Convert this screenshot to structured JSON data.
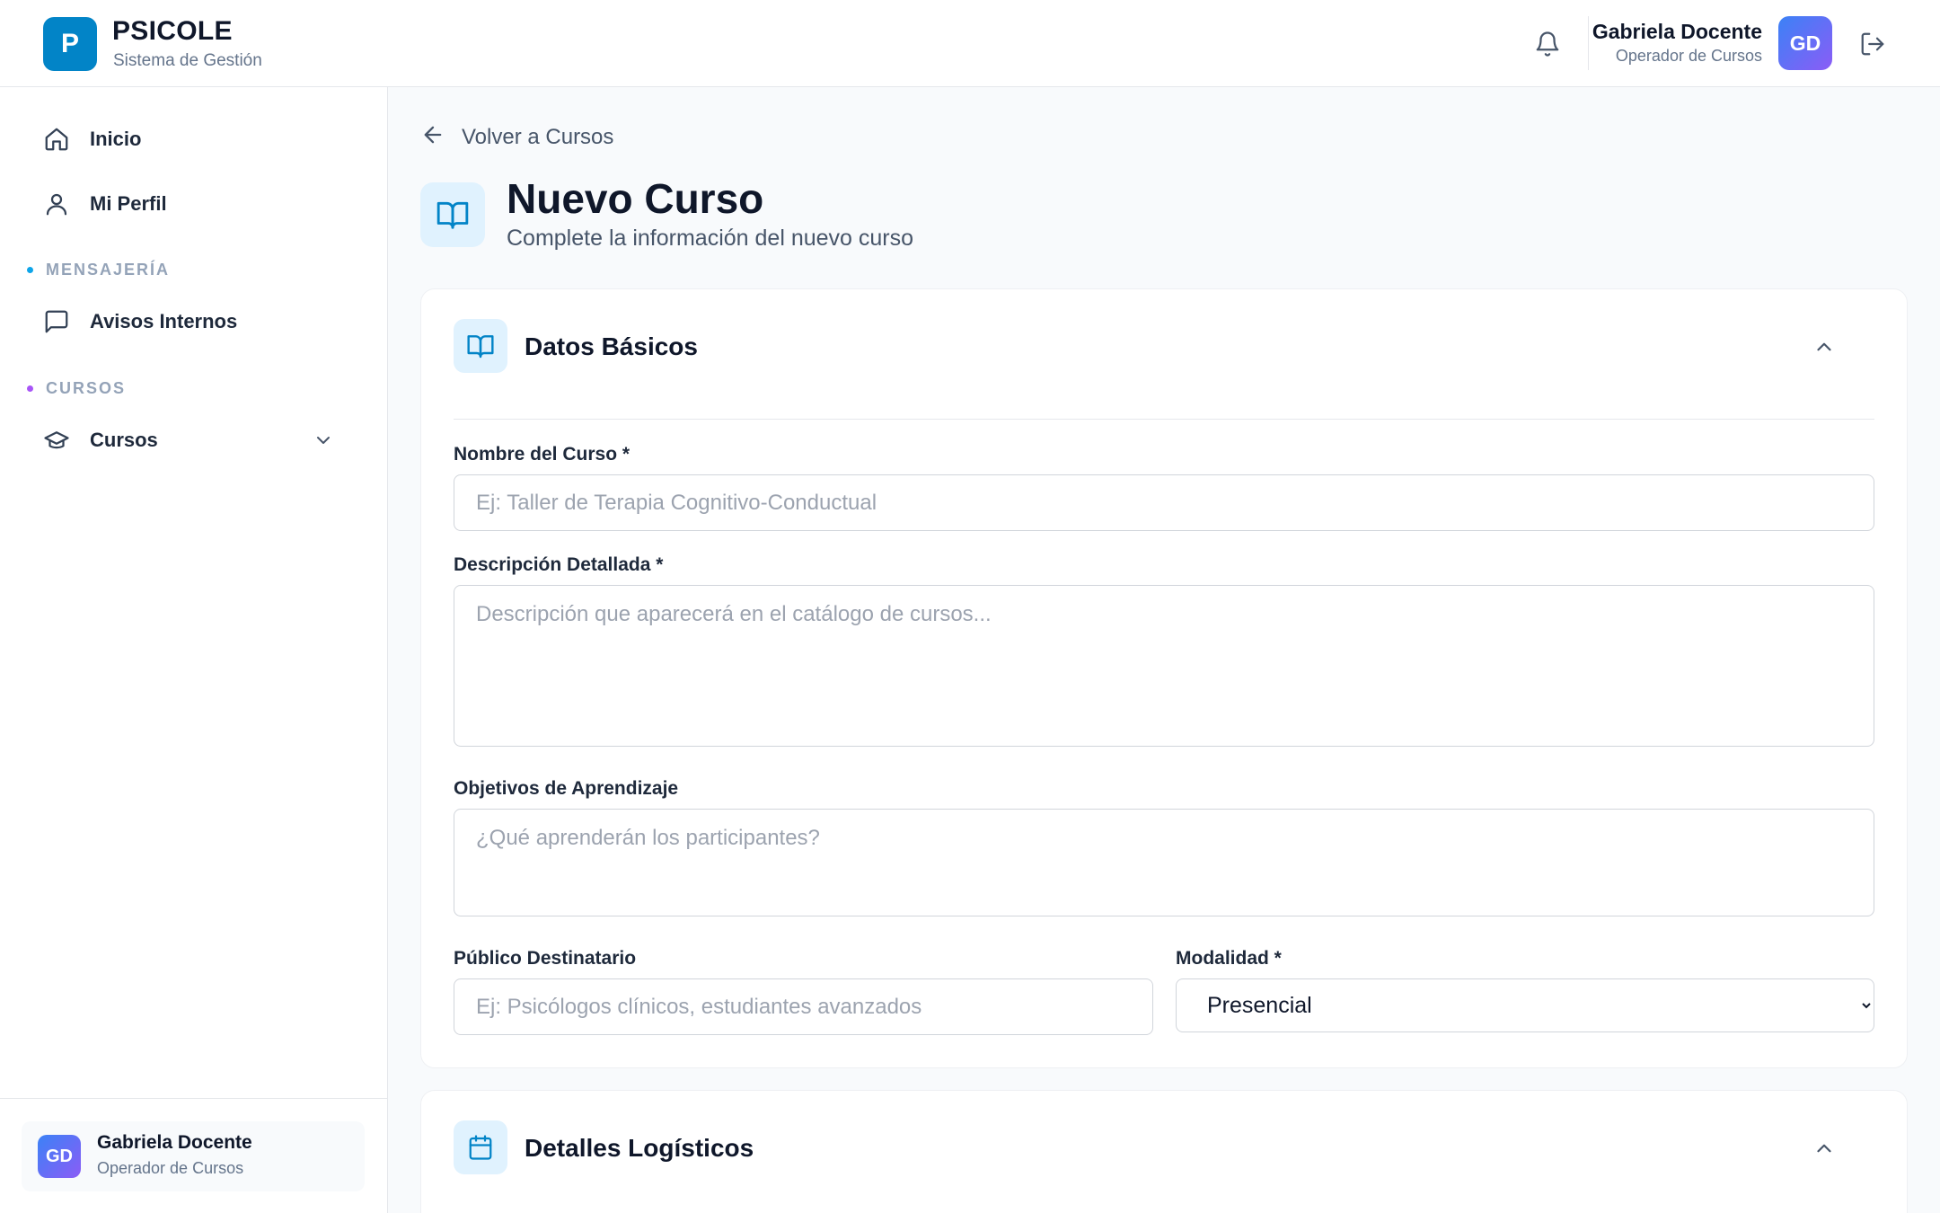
{
  "brand": {
    "logo_letter": "P",
    "name": "PSICOLE",
    "subtitle": "Sistema de Gestión",
    "color": "#0284c7"
  },
  "header": {
    "user_name": "Gabriela Docente",
    "user_role": "Operador de Cursos",
    "avatar_initials": "GD",
    "icons": [
      "bell-icon",
      "logout-icon"
    ]
  },
  "sidebar": {
    "items": [
      {
        "label": "Inicio",
        "icon": "home-icon"
      },
      {
        "label": "Mi Perfil",
        "icon": "user-icon"
      }
    ],
    "sections": [
      {
        "label": "MENSAJERÍA",
        "dot_color": "#0ea5e9",
        "items": [
          {
            "label": "Avisos Internos",
            "icon": "message-icon"
          }
        ]
      },
      {
        "label": "CURSOS",
        "dot_color": "#a855f7",
        "items": [
          {
            "label": "Cursos",
            "icon": "graduation-cap-icon",
            "expandable": true
          }
        ]
      }
    ],
    "footer_user": {
      "name": "Gabriela Docente",
      "role": "Operador de Cursos",
      "avatar_initials": "GD"
    }
  },
  "main": {
    "back_label": "Volver a Cursos",
    "title": "Nuevo Curso",
    "subtitle": "Complete la información del nuevo curso",
    "basic_card": {
      "title": "Datos Básicos",
      "fields": {
        "name": {
          "label": "Nombre del Curso *",
          "value": "",
          "placeholder": "Ej: Taller de Terapia Cognitivo-Conductual"
        },
        "description": {
          "label": "Descripción Detallada *",
          "value": "",
          "placeholder": "Descripción que aparecerá en el catálogo de cursos..."
        },
        "objectives": {
          "label": "Objetivos de Aprendizaje",
          "value": "",
          "placeholder": "¿Qué aprenderán los participantes?"
        },
        "audience": {
          "label": "Público Destinatario",
          "value": "",
          "placeholder": "Ej: Psicólogos clínicos, estudiantes avanzados"
        },
        "modality": {
          "label": "Modalidad *",
          "selected": "Presencial"
        }
      }
    },
    "logistics_card": {
      "title": "Detalles Logísticos"
    }
  }
}
